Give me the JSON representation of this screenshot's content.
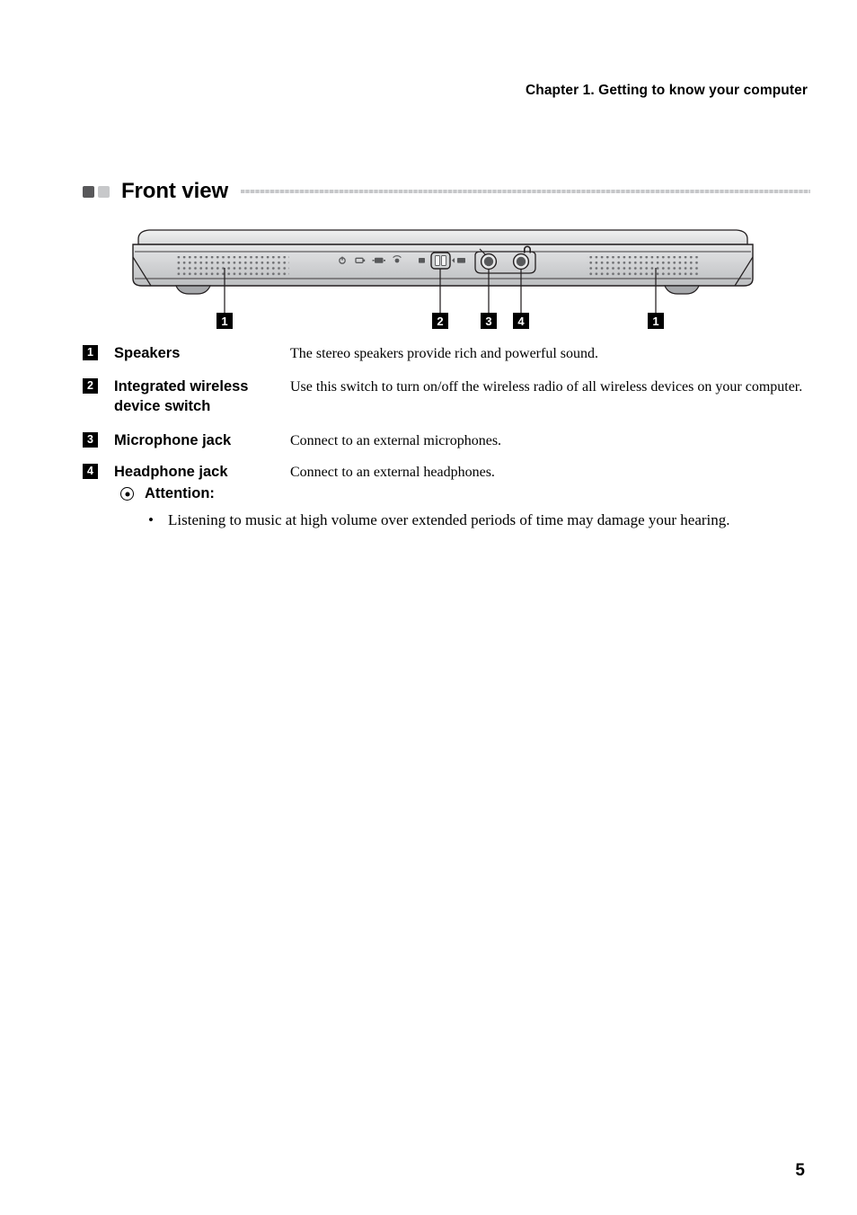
{
  "header": {
    "chapter_title": "Chapter 1. Getting to know your computer"
  },
  "section": {
    "title": "Front view",
    "marker_dark_color": "#58585a",
    "marker_light_color": "#c7c8ca",
    "rule_color": "#c6c7c9"
  },
  "figure": {
    "caption_alt": "front-view-of-laptop-illustration",
    "callouts": [
      {
        "number": "1",
        "target": "left-speaker-grille"
      },
      {
        "number": "2",
        "target": "wireless-device-switch"
      },
      {
        "number": "3",
        "target": "microphone-jack"
      },
      {
        "number": "4",
        "target": "headphone-jack"
      },
      {
        "number": "1",
        "target": "right-speaker-grille"
      }
    ],
    "indicator_icons": [
      "power-icon",
      "battery-icon",
      "drive-activity-icon",
      "wireless-icon"
    ],
    "jack_icons": [
      "microphone-icon",
      "headphone-icon"
    ]
  },
  "items": [
    {
      "number": "1",
      "label": "Speakers",
      "description": "The stereo speakers provide rich and powerful sound."
    },
    {
      "number": "2",
      "label": "Integrated wireless device switch",
      "description": "Use this switch to turn on/off the wireless radio of all wireless devices on your computer."
    },
    {
      "number": "3",
      "label": "Microphone jack",
      "description": "Connect to an external microphones."
    },
    {
      "number": "4",
      "label": "Headphone jack",
      "description": "Connect to an external headphones."
    }
  ],
  "note": {
    "title": "Attention:",
    "bullet_char": "•",
    "bullets": [
      "Listening to music at high volume over extended periods of time may damage your hearing."
    ]
  },
  "footer": {
    "page_number": "5"
  }
}
